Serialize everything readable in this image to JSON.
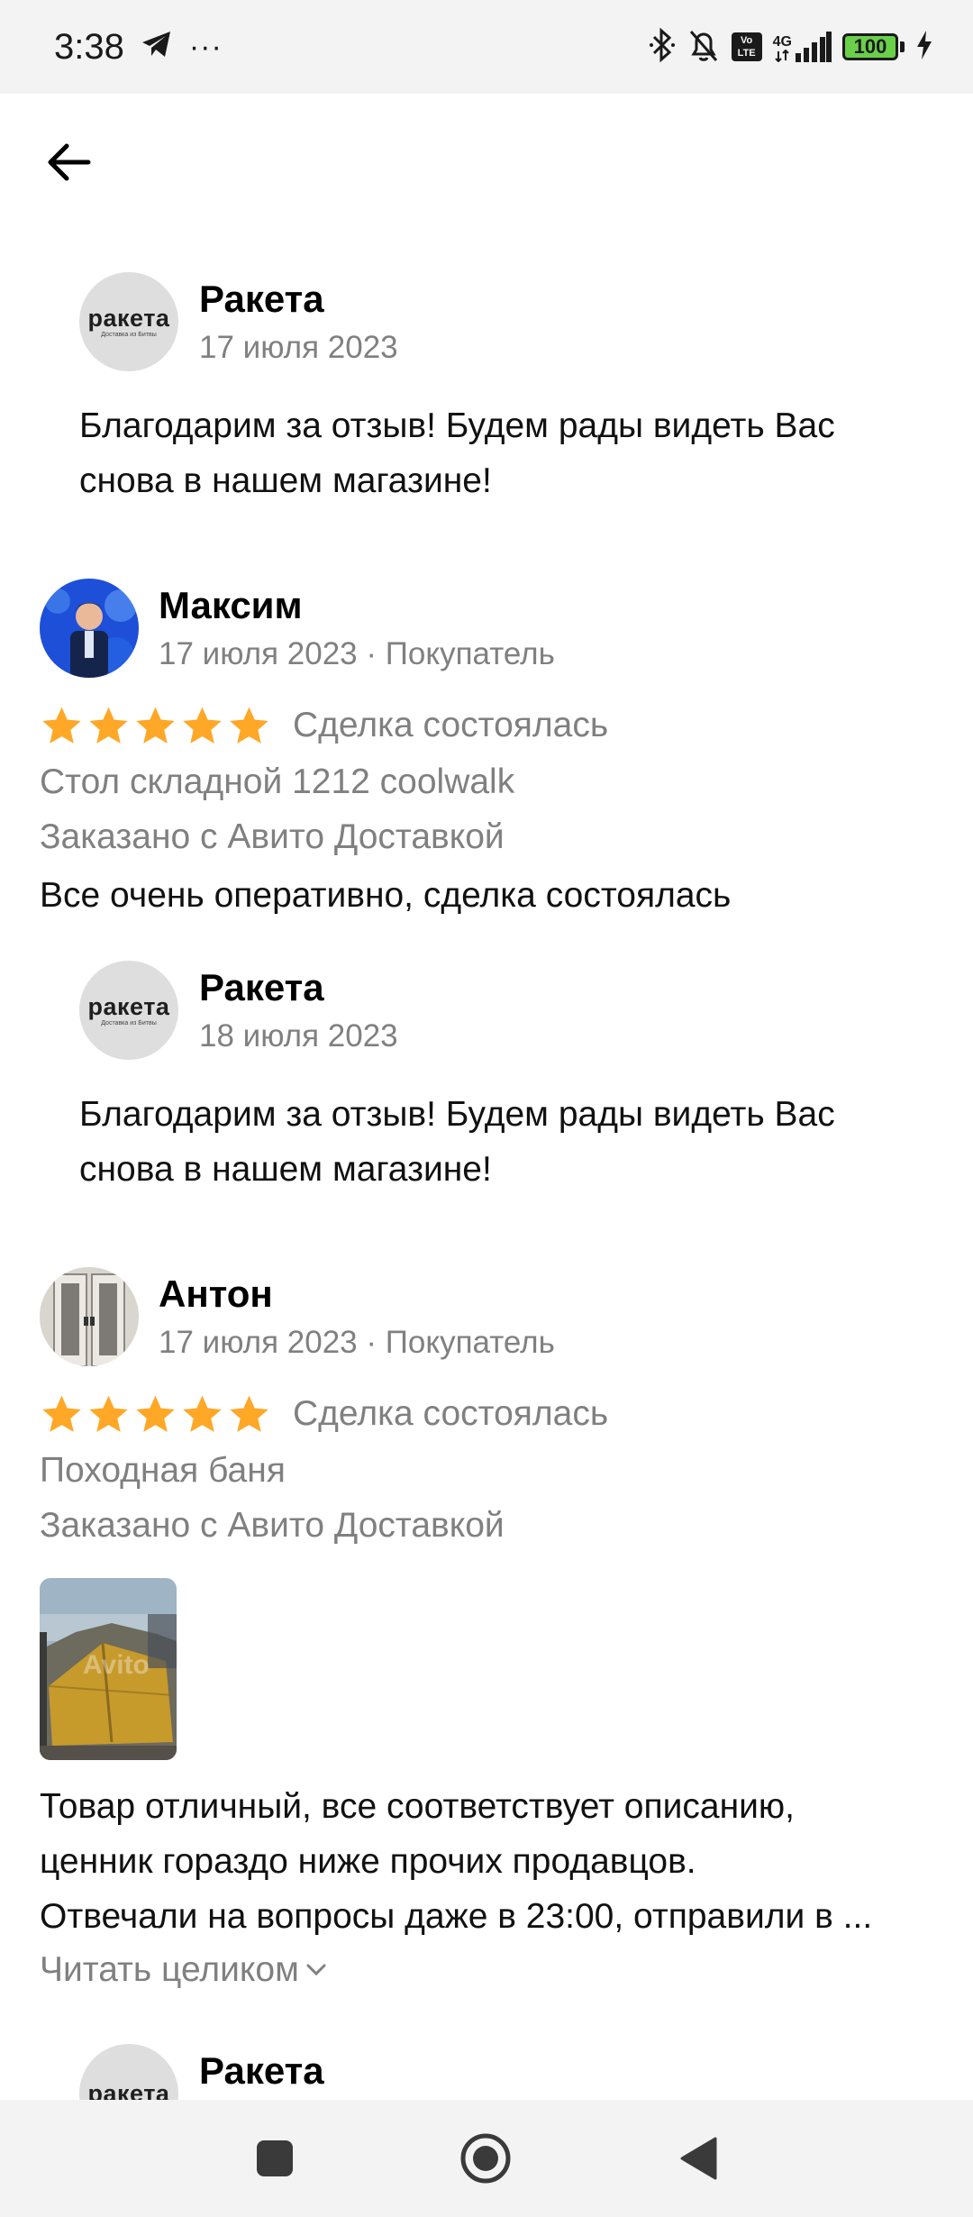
{
  "status_bar": {
    "time": "3:38",
    "more": "···",
    "network": "4G",
    "volte": "Vo LTE",
    "battery": "100"
  },
  "replies": [
    {
      "name": "Ракета",
      "date": "17 июля 2023",
      "text": "Благодарим за отзыв! Будем рады видеть Вас снова в нашем магазине!",
      "logo_word": "ракета",
      "logo_sub": "Доставка из Битвы"
    },
    {
      "name": "Ракета",
      "date": "18 июля 2023",
      "text": "Благодарим за отзыв! Будем рады видеть Вас снова в нашем магазине!",
      "logo_word": "ракета",
      "logo_sub": "Доставка из Битвы"
    },
    {
      "name": "Ракета",
      "logo_word": "ракета"
    }
  ],
  "reviews": [
    {
      "name": "Максим",
      "meta": "17 июля 2023 · Покупатель",
      "rating": 5,
      "deal_status": "Сделка состоялась",
      "product": "Стол складной 1212 coolwalk",
      "delivery": "Заказано с Авито Доставкой",
      "text": "Все очень оперативно, сделка состоялась"
    },
    {
      "name": "Антон",
      "meta": "17 июля 2023 · Покупатель",
      "rating": 5,
      "deal_status": "Сделка состоялась",
      "product": "Походная баня",
      "delivery": "Заказано с Авито Доставкой",
      "text_lines": [
        "Товар отличный, все соответствует описанию,",
        "ценник гораздо ниже прочих продавцов.",
        "Отвечали на вопросы даже в 23:00, отправили в ..."
      ],
      "photo_watermark": "Avito",
      "read_more": "Читать целиком"
    }
  ],
  "colors": {
    "star": "#FFA726",
    "muted": "#808080",
    "status_bg": "#f3f3f3"
  }
}
